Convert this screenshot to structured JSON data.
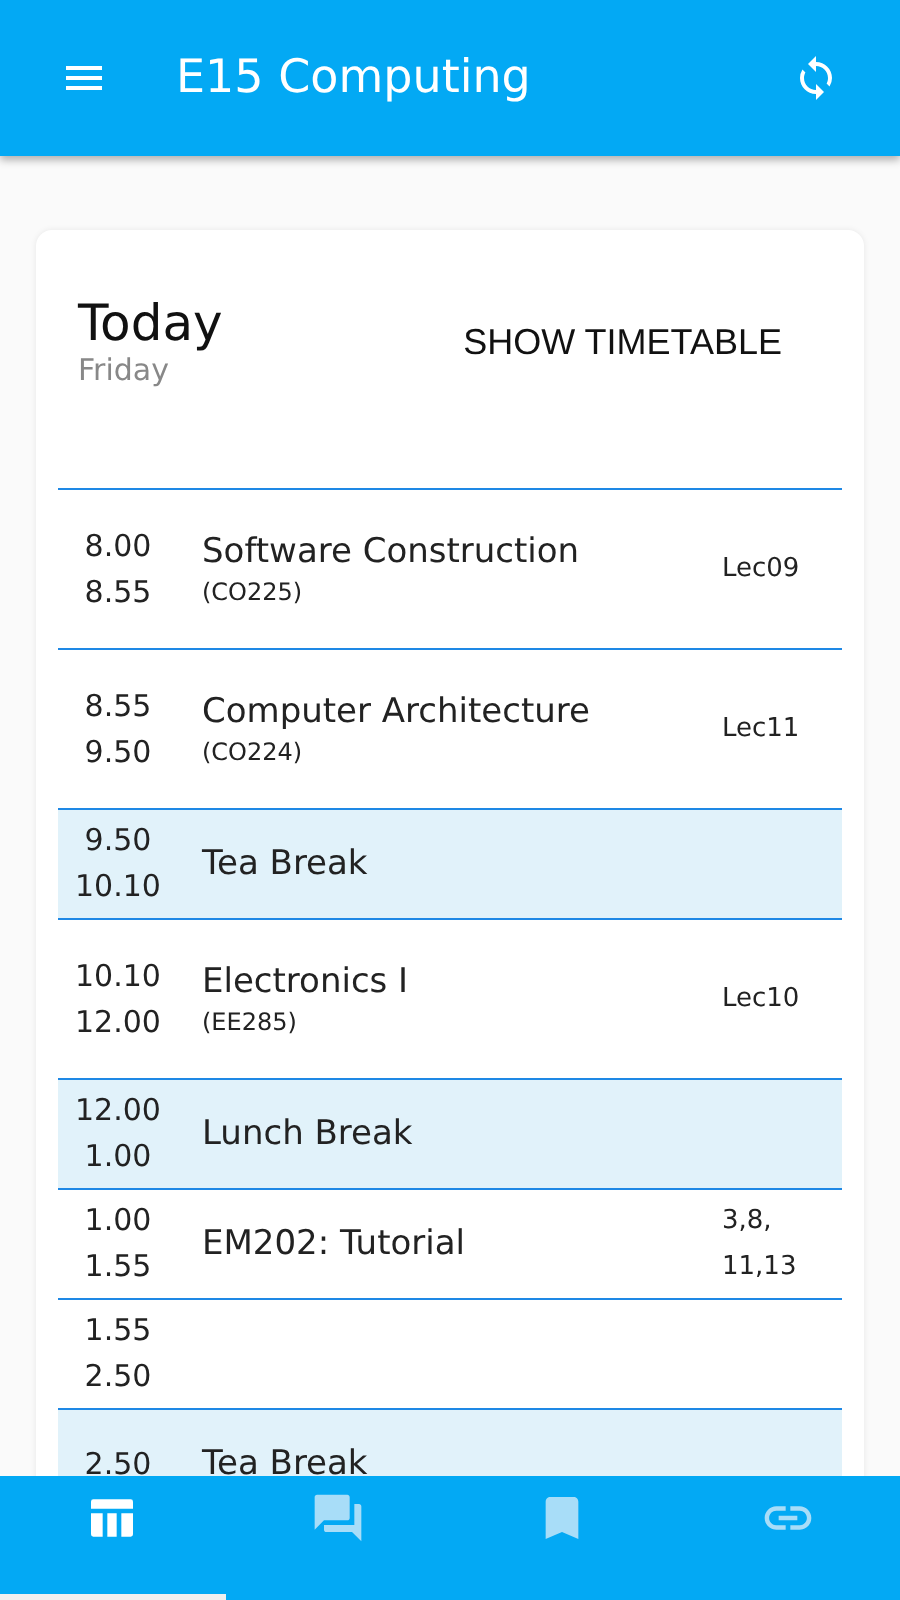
{
  "app_bar": {
    "title": "E15 Computing"
  },
  "card": {
    "heading": "Today",
    "day": "Friday",
    "action": "SHOW TIMETABLE"
  },
  "rows": [
    {
      "kind": "class",
      "start": "8.00",
      "end": "8.55",
      "title": "Software Construction",
      "code": "(CO225)",
      "room": "Lec09"
    },
    {
      "kind": "class",
      "start": "8.55",
      "end": "9.50",
      "title": "Computer Architecture",
      "code": "(CO224)",
      "room": "Lec11"
    },
    {
      "kind": "break",
      "start": "9.50",
      "end": "10.10",
      "title": "Tea Break"
    },
    {
      "kind": "class",
      "start": "10.10",
      "end": "12.00",
      "title": "Electronics I",
      "code": "(EE285)",
      "room": "Lec10"
    },
    {
      "kind": "break",
      "start": "12.00",
      "end": "1.00",
      "title": "Lunch Break"
    },
    {
      "kind": "class",
      "start": "1.00",
      "end": "1.55",
      "title": "EM202: Tutorial",
      "room": "3,8, 11,13"
    },
    {
      "kind": "free",
      "start": "1.55",
      "end": "2.50"
    },
    {
      "kind": "break",
      "start": "2.50",
      "title": "Tea Break"
    }
  ],
  "bottom_nav": [
    {
      "kind": "table",
      "selected": true
    },
    {
      "kind": "chat",
      "selected": false
    },
    {
      "kind": "bookmark",
      "selected": false
    },
    {
      "kind": "link",
      "selected": false
    }
  ]
}
